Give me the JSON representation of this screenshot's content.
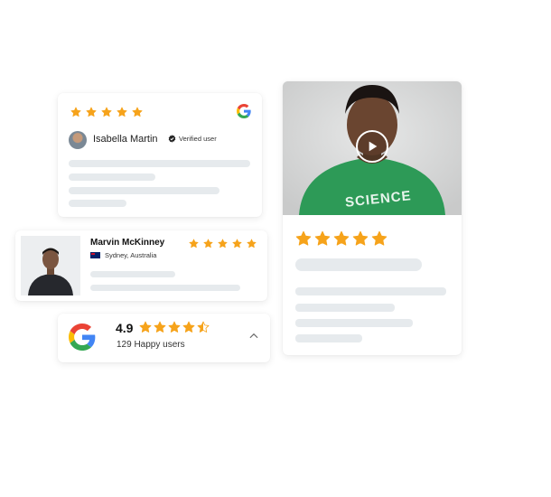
{
  "colors": {
    "star": "#f6a31b",
    "skeleton": "#e6eaed",
    "google_blue": "#4285F4",
    "google_red": "#EA4335",
    "google_yellow": "#FBBC05",
    "google_green": "#34A853",
    "shirt_green": "#2d9a57"
  },
  "review_card_1": {
    "stars": 5,
    "source_icon": "google-icon",
    "reviewer_name": "Isabella Martin",
    "verified_label": "Verified user"
  },
  "review_card_2": {
    "reviewer_name": "Marvin McKinney",
    "location": "Sydney, Australia",
    "flag_icon": "australia-flag-icon",
    "stars": 5
  },
  "summary": {
    "rating": "4.9",
    "stars": 4.5,
    "count": "129",
    "count_label": "Happy users",
    "count_text": "129  Happy users"
  },
  "video_card": {
    "shirt_text": "SCIENCE",
    "play_icon": "play-icon",
    "stars": 5
  }
}
